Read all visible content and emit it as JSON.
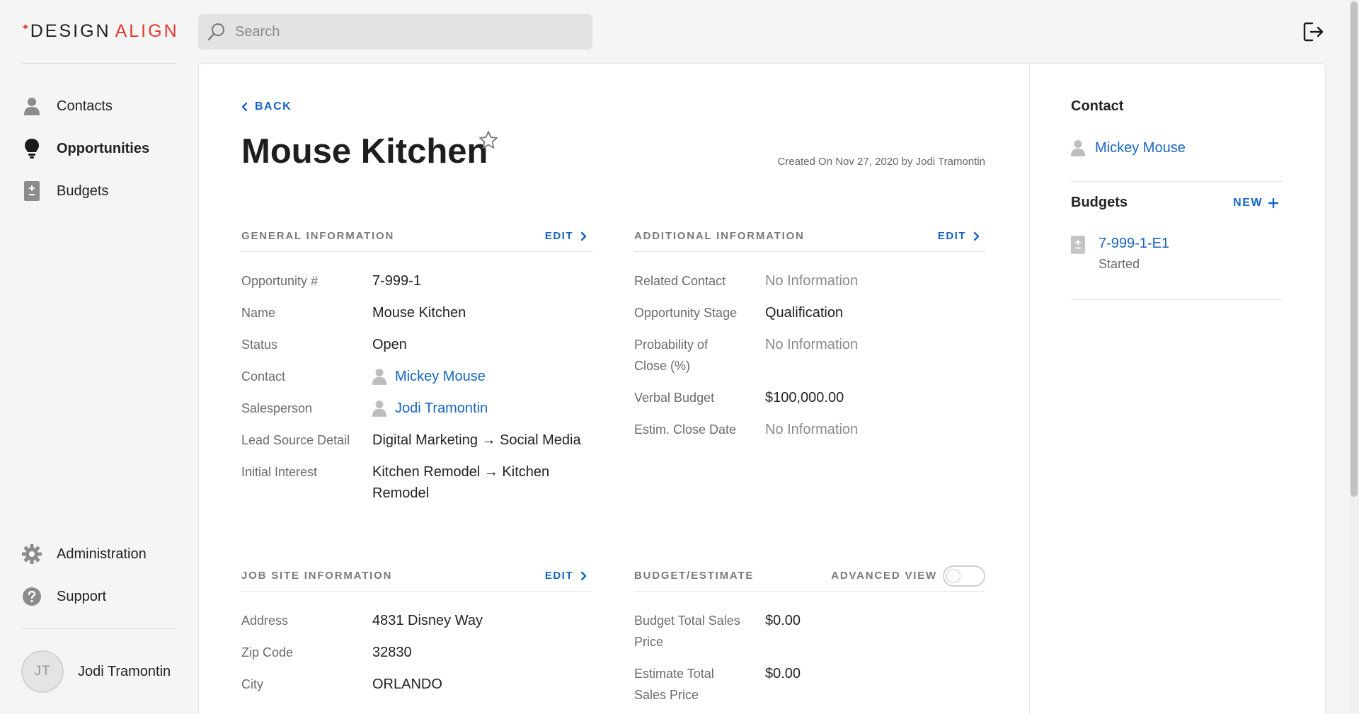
{
  "brand": {
    "part1": "DESIGN",
    "part2": "ALIGN",
    "accent": "#e03a2e",
    "link_color": "#1565c0"
  },
  "search": {
    "placeholder": "Search"
  },
  "sidebar": {
    "top_items": [
      {
        "label": "Contacts",
        "icon": "person-icon"
      },
      {
        "label": "Opportunities",
        "icon": "lightbulb-icon",
        "active": true
      },
      {
        "label": "Budgets",
        "icon": "budget-icon"
      }
    ],
    "bottom_items": [
      {
        "label": "Administration",
        "icon": "gear-icon"
      },
      {
        "label": "Support",
        "icon": "help-icon"
      }
    ],
    "user": {
      "initials": "JT",
      "name": "Jodi Tramontin"
    }
  },
  "header": {
    "back_label": "BACK",
    "title": "Mouse Kitchen",
    "created": "Created On Nov 27, 2020 by Jodi Tramontin"
  },
  "general": {
    "title": "GENERAL INFORMATION",
    "edit": "EDIT",
    "rows": {
      "opportunity_label": "Opportunity #",
      "opportunity_value": "7-999-1",
      "name_label": "Name",
      "name_value": "Mouse Kitchen",
      "status_label": "Status",
      "status_value": "Open",
      "contact_label": "Contact",
      "contact_value": "Mickey Mouse",
      "salesperson_label": "Salesperson",
      "salesperson_value": "Jodi Tramontin",
      "lead_label": "Lead Source Detail",
      "lead_value": "Digital Marketing → Social Media",
      "interest_label": "Initial Interest",
      "interest_value": "Kitchen Remodel → Kitchen Remodel"
    }
  },
  "additional": {
    "title": "ADDITIONAL INFORMATION",
    "edit": "EDIT",
    "rows": {
      "related_label": "Related Contact",
      "related_value": "No Information",
      "stage_label": "Opportunity Stage",
      "stage_value": "Qualification",
      "prob_label": "Probability of Close (%)",
      "prob_value": "No Information",
      "verbal_label": "Verbal Budget",
      "verbal_value": "$100,000.00",
      "close_label": "Estim. Close Date",
      "close_value": "No Information"
    }
  },
  "jobsite": {
    "title": "JOB SITE INFORMATION",
    "edit": "EDIT",
    "rows": {
      "address_label": "Address",
      "address_value": "4831 Disney Way",
      "zip_label": "Zip Code",
      "zip_value": "32830",
      "city_label": "City",
      "city_value": "ORLANDO"
    }
  },
  "budget_estimate": {
    "title": "BUDGET/ESTIMATE",
    "toggle_label": "ADVANCED VIEW",
    "toggle_on": false,
    "rows": {
      "budget_total_label": "Budget Total Sales Price",
      "budget_total_value": "$0.00",
      "estimate_total_label": "Estimate Total Sales Price",
      "estimate_total_value": "$0.00"
    }
  },
  "right_panel": {
    "contact_title": "Contact",
    "contact_name": "Mickey Mouse",
    "budgets_title": "Budgets",
    "new_label": "NEW",
    "budget_items": [
      {
        "id": "7-999-1-E1",
        "status": "Started"
      }
    ]
  }
}
